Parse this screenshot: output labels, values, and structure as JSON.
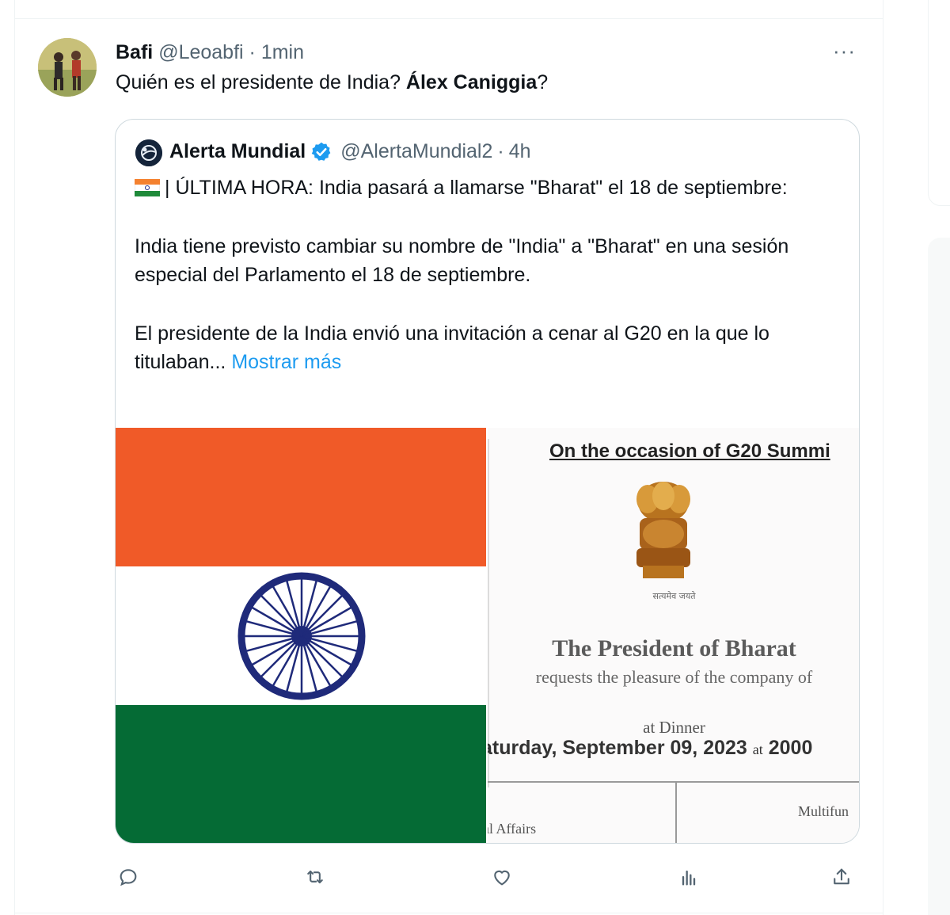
{
  "tweet": {
    "author_name": "Bafi",
    "author_handle": "@Leoabfi",
    "separator": "·",
    "time": "1min",
    "more_label": "···",
    "text_plain": "Quién es el presidente de India? ",
    "text_bold": "Álex Caniggia",
    "text_end": "?"
  },
  "quote": {
    "author_name": "Alerta Mundial",
    "author_handle": "@AlertaMundial2",
    "separator": "·",
    "time": "4h",
    "line1": "| ÚLTIMA HORA: India pasará a llamarse \"Bharat\" el 18 de septiembre:",
    "line2": "India tiene previsto cambiar su nombre de \"India\" a \"Bharat\" en una sesión especial del Parlamento el 18 de septiembre.",
    "line3": "El presidente de la India envió una invitación a cenar al G20 en la que lo titulaban...",
    "show_more": "Mostrar más",
    "flag_icon": "india-flag-emoji"
  },
  "invitation": {
    "occasion": "On the occasion of G20  Summi",
    "motto": "सत्यमेव जयते",
    "president": "The President of Bharat",
    "requests": "requests the pleasure of the company of",
    "at_dinner": "at Dinner",
    "date_main": "aturday,  September 09, 2023",
    "date_at": "at",
    "date_time": "2000",
    "affairs": "al Affairs",
    "multifun": "Multifun"
  },
  "actions": {
    "reply": "reply-icon",
    "retweet": "retweet-icon",
    "like": "like-icon",
    "views": "views-icon",
    "share": "share-icon"
  },
  "colors": {
    "link": "#1d9bf0",
    "muted": "#536471",
    "saffron": "#f05a28",
    "green": "#056b35",
    "chakra": "#1f2a7a"
  }
}
